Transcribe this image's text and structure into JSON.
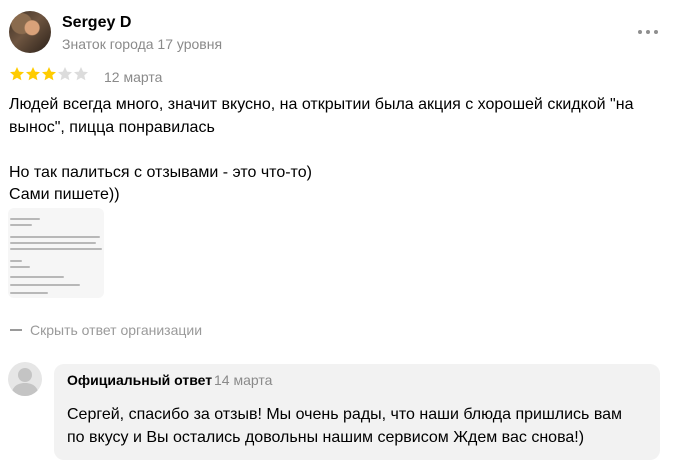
{
  "author": {
    "name": "Sergey D",
    "level": "Знаток города 17 уровня"
  },
  "review": {
    "rating": 3,
    "max_rating": 5,
    "date": "12 марта",
    "text_lines": [
      "Людей всегда много, значит вкусно, на открытии была акция с хорошей скидкой \"на",
      "вынос\", пицца понравилась",
      "Но так палиться с отзывами - это что-то)",
      "Сами пишете))"
    ]
  },
  "colors": {
    "star_filled": "#ffcc00",
    "star_empty": "#dcdcdc",
    "muted_text": "#8a8a8a",
    "reply_background": "#f2f2f2"
  },
  "hide_reply_label": "Скрыть ответ организации",
  "official_reply": {
    "title": "Официальный ответ",
    "date": "14 марта",
    "text_lines": [
      "Сергей, спасибо за отзыв! Мы очень рады, что наши блюда пришлись вам",
      "по вкусу и Вы остались довольны нашим сервисом Ждем вас снова!)"
    ]
  }
}
